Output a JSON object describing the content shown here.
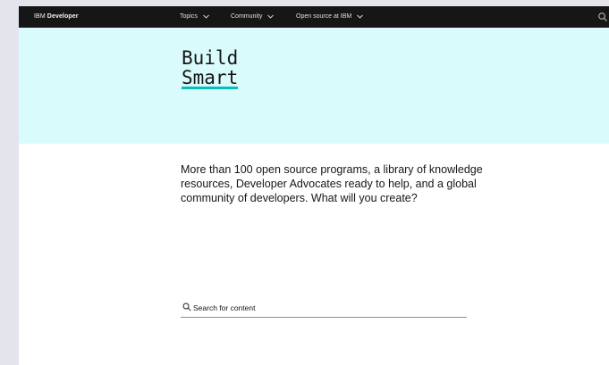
{
  "header": {
    "brand_prefix": "IBM",
    "brand_name": "Developer",
    "nav": [
      {
        "label": "Topics"
      },
      {
        "label": "Community"
      },
      {
        "label": "Open source at IBM"
      }
    ]
  },
  "hero": {
    "title_line1": "Build",
    "title_line2": "Smart",
    "accent_color": "#08bdba",
    "background": "#d9fbfb"
  },
  "intro": {
    "text": "More than 100 open source programs, a library of knowledge resources, Developer Advocates ready to help, and a global community of developers. What will you create?"
  },
  "search": {
    "placeholder": "Search for content",
    "icon": "search-icon"
  }
}
